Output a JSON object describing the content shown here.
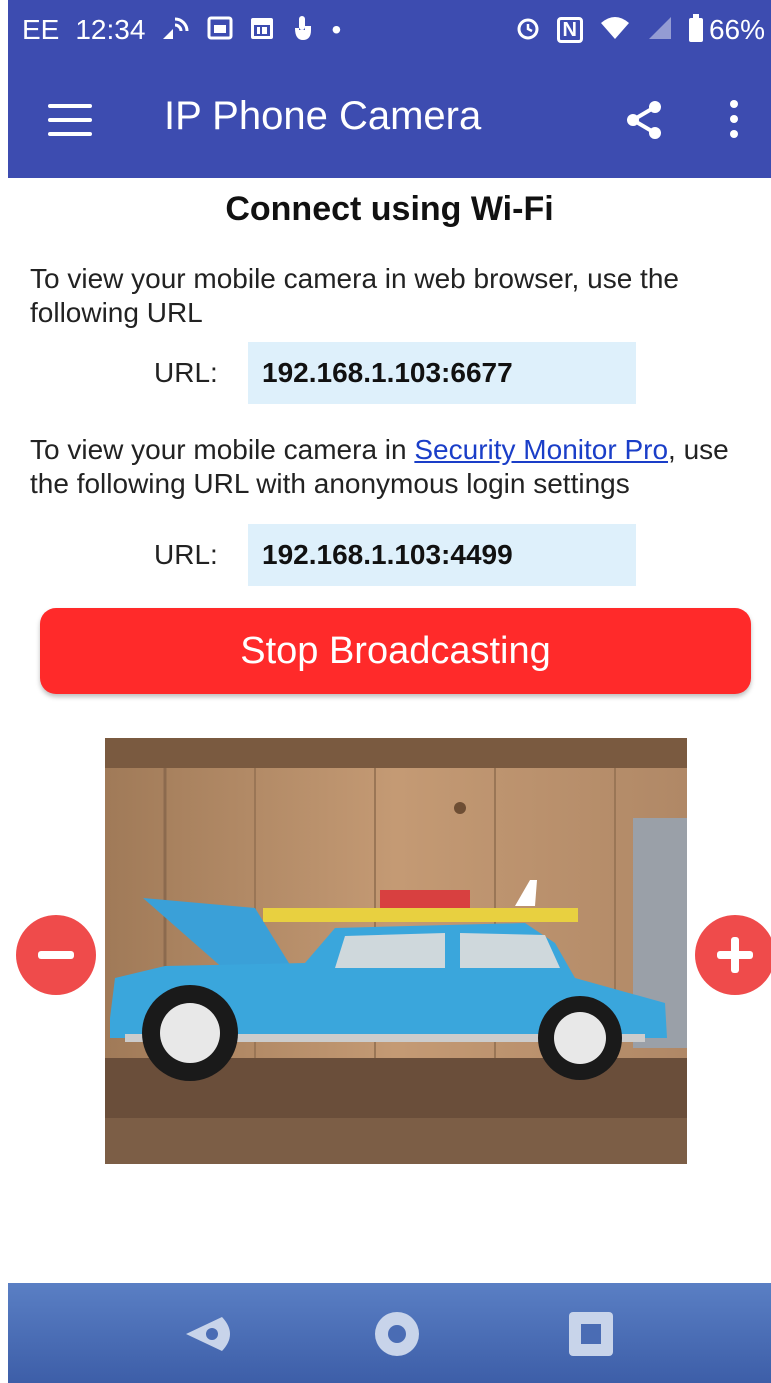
{
  "status_bar": {
    "carrier": "EE",
    "time": "12:34",
    "dot": "•",
    "nfc": "N",
    "battery": "66%"
  },
  "app_bar": {
    "title": "IP Phone Camera"
  },
  "content": {
    "heading": "Connect using Wi-Fi",
    "browser_instruction": "To view your mobile camera in web browser, use the following URL",
    "url_label": "URL:",
    "browser_url": "192.168.1.103:6677",
    "monitor_instruction_before": "To view your mobile camera in ",
    "monitor_link": "Security Monitor Pro",
    "monitor_instruction_after": ", use the following URL with anonymous login settings",
    "monitor_url": "192.168.1.103:4499",
    "stop_button": "Stop Broadcasting"
  },
  "colors": {
    "app_bar": "#3d4cb0",
    "stop_button": "#ff2a2a",
    "url_box": "#def0fb",
    "zoom_button": "#ef4b4b",
    "link": "#1a3ec8"
  }
}
